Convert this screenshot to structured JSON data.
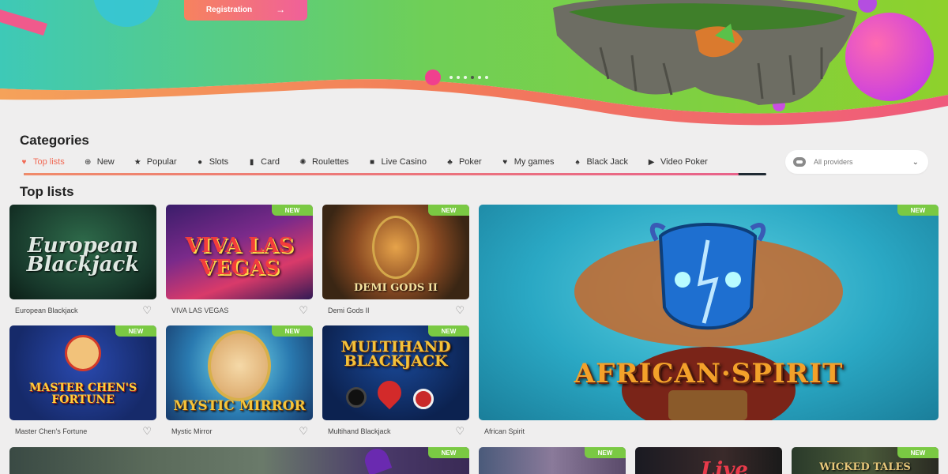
{
  "hero": {
    "register_label": "Registration",
    "slider_count": 6,
    "slider_active_index": 3
  },
  "categories": {
    "title": "Categories",
    "tabs": [
      {
        "label": "Top lists",
        "icon": "heart-icon"
      },
      {
        "label": "New",
        "icon": "plus-circle-icon"
      },
      {
        "label": "Popular",
        "icon": "star-icon"
      },
      {
        "label": "Slots",
        "icon": "slots-icon"
      },
      {
        "label": "Card",
        "icon": "card-icon"
      },
      {
        "label": "Roulettes",
        "icon": "roulette-icon"
      },
      {
        "label": "Live Casino",
        "icon": "camera-icon"
      },
      {
        "label": "Poker",
        "icon": "club-icon"
      },
      {
        "label": "My games",
        "icon": "heart-icon"
      },
      {
        "label": "Black Jack",
        "icon": "spade-icon"
      },
      {
        "label": "Video Poker",
        "icon": "play-icon"
      }
    ],
    "active_tab": "Top lists",
    "providers_placeholder": "All providers"
  },
  "top_lists": {
    "title": "Top lists",
    "new_badge": "NEW",
    "games": [
      {
        "name": "European Blackjack",
        "logo": "European Blackjack",
        "is_new": false
      },
      {
        "name": "VIVA LAS VEGAS",
        "logo": "VIVA LAS VEGAS",
        "is_new": true
      },
      {
        "name": "Demi Gods II",
        "logo": "DEMI GODS II",
        "is_new": true
      },
      {
        "name": "African Spirit",
        "logo": "AFRICAN·SPIRIT",
        "is_new": true
      },
      {
        "name": "Master Chen's Fortune",
        "logo": "MASTER CHEN'S FORTUNE",
        "is_new": true
      },
      {
        "name": "Mystic Mirror",
        "logo": "MYSTIC MIRROR",
        "is_new": true
      },
      {
        "name": "Multihand Blackjack",
        "logo": "MULTIHAND BLACKJACK",
        "is_new": true
      },
      {
        "name": "",
        "logo": "",
        "is_new": true
      },
      {
        "name": "",
        "logo": "",
        "is_new": true
      },
      {
        "name": "",
        "logo": "Live",
        "is_new": false
      },
      {
        "name": "",
        "logo": "WICKED TALES",
        "is_new": true
      }
    ]
  },
  "colors": {
    "accent": "#f16a55",
    "new_badge": "#7ac943",
    "background": "#efeeee"
  }
}
